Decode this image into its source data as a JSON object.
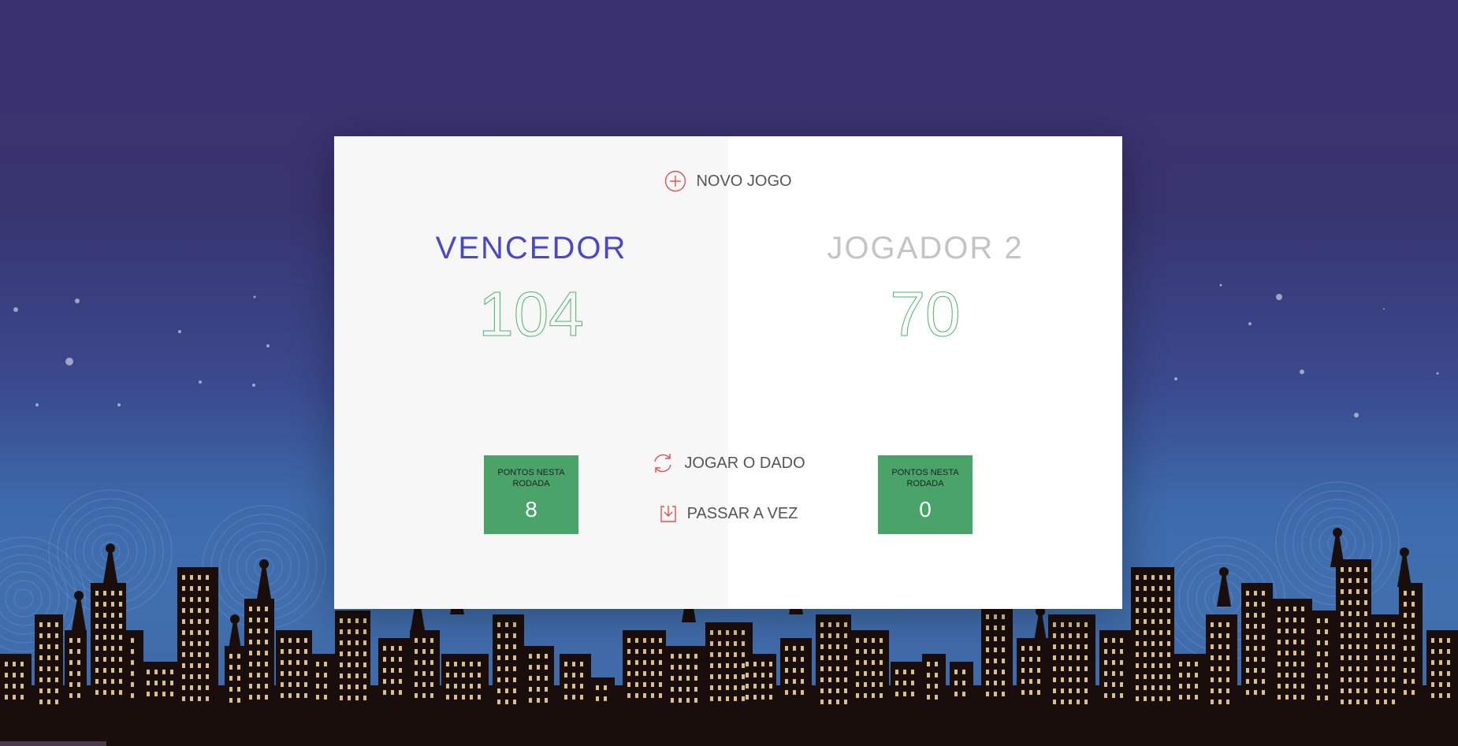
{
  "buttons": {
    "new_game": "NOVO JOGO",
    "roll_dice": "JOGAR O DADO",
    "hold": "PASSAR A VEZ"
  },
  "players": [
    {
      "name": "VENCEDOR",
      "score": "104",
      "current_label": "PONTOS NESTA RODADA",
      "current_score": "8",
      "status": "winner"
    },
    {
      "name": "JOGADOR 2",
      "score": "70",
      "current_label": "PONTOS NESTA RODADA",
      "current_score": "0",
      "status": "inactive"
    }
  ],
  "colors": {
    "winner_name": "#4a48c8",
    "inactive_name": "#c4c4c4",
    "score": "#4eb36b",
    "current_box": "#4aa46a",
    "icon_accent": "#e05050",
    "sky_top": "#3a3170",
    "sky_bottom": "#416fae",
    "buildings": "#1a0e0c",
    "windows": "#d9c08a"
  },
  "icons": {
    "new_game": "plus-circle-icon",
    "roll_dice": "refresh-icon",
    "hold": "download-icon"
  }
}
